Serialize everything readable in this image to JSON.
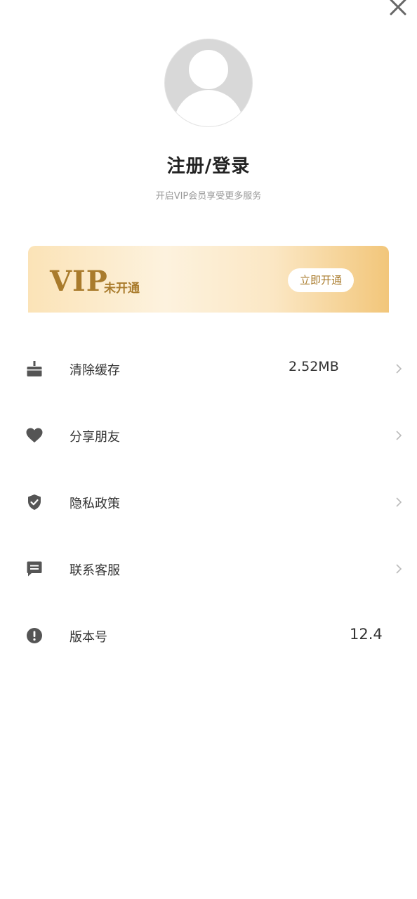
{
  "header": {
    "close_icon": "close-icon"
  },
  "profile": {
    "avatar_icon": "default-avatar",
    "title": "注册/登录",
    "subtitle": "开启VIP会员享受更多服务"
  },
  "vip": {
    "logo": "VIP",
    "status": "未开通",
    "button_label": "立即开通",
    "accent_color": "#a97b2c"
  },
  "menu": [
    {
      "label": "清除缓存",
      "icon": "cache-icon",
      "value": "2.52MB",
      "arrow": true
    },
    {
      "label": "分享朋友",
      "icon": "heart-icon",
      "value": "",
      "arrow": true
    },
    {
      "label": "隐私政策",
      "icon": "shield-check-icon",
      "value": "",
      "arrow": true
    },
    {
      "label": "联系客服",
      "icon": "message-icon",
      "value": "",
      "arrow": true
    },
    {
      "label": "版本号",
      "icon": "info-icon",
      "value": "12.4",
      "arrow": false
    }
  ]
}
